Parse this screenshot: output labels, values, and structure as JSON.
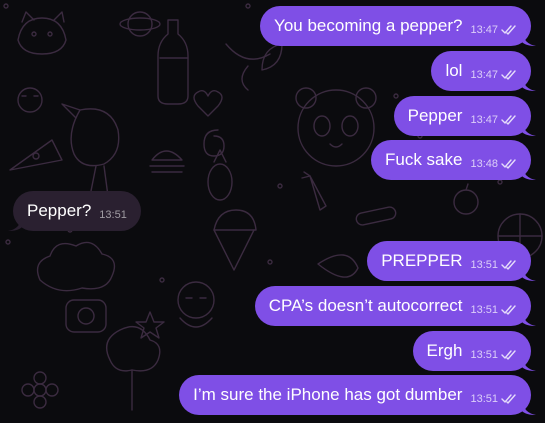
{
  "colors": {
    "background": "#0b0b0e",
    "doodle_stroke": "#3b2b40",
    "outgoing_bubble": "#7f4fe6",
    "incoming_bubble": "#2a2030"
  },
  "messages": [
    {
      "direction": "outgoing",
      "text": "You becoming a pepper?",
      "time": "13:47",
      "status_icon": "double-check-icon"
    },
    {
      "direction": "outgoing",
      "text": "lol",
      "time": "13:47",
      "status_icon": "double-check-icon"
    },
    {
      "direction": "outgoing",
      "text": "Pepper",
      "time": "13:47",
      "status_icon": "double-check-icon"
    },
    {
      "direction": "outgoing",
      "text": "Fuck sake",
      "time": "13:48",
      "status_icon": "double-check-icon"
    },
    {
      "direction": "incoming",
      "text": "Pepper?",
      "time": "13:51"
    },
    {
      "direction": "outgoing",
      "text": "PREPPER",
      "time": "13:51",
      "status_icon": "double-check-icon"
    },
    {
      "direction": "outgoing",
      "text": "CPA’s doesn’t autocorrect",
      "time": "13:51",
      "status_icon": "double-check-icon"
    },
    {
      "direction": "outgoing",
      "text": "Ergh",
      "time": "13:51",
      "status_icon": "double-check-icon"
    },
    {
      "direction": "outgoing",
      "text": "I’m sure the iPhone has got dumber",
      "time": "13:51",
      "status_icon": "double-check-icon"
    }
  ]
}
